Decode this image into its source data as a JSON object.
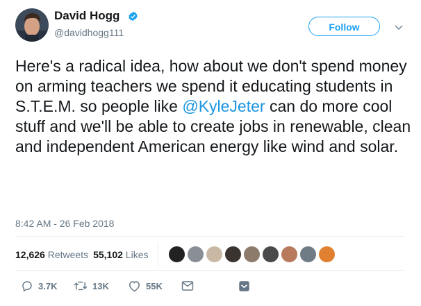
{
  "user": {
    "name": "David Hogg",
    "handle": "@davidhogg111"
  },
  "follow_label": "Follow",
  "tweet": {
    "before": "Here's a radical idea, how about we don't spend money on arming teachers we spend it educating  students in S.T.E.M. so people like ",
    "mention": "@KyleJeter",
    "after": " can do more cool stuff and we'll be able to create jobs in renewable, clean and independent American energy like wind and solar."
  },
  "timestamp": "8:42 AM - 26 Feb 2018",
  "stats": {
    "retweets_count": "12,626",
    "retweets_label": "Retweets",
    "likes_count": "55,102",
    "likes_label": "Likes"
  },
  "actions": {
    "replies": "3.7K",
    "retweets": "13K",
    "likes": "55K"
  },
  "colors": {
    "accent": "#1da1f2",
    "mention": "#1b95e0",
    "muted": "#657786"
  },
  "icons": [
    "verified-badge-icon",
    "chevron-down-icon",
    "reply-icon",
    "retweet-icon",
    "like-icon",
    "message-icon",
    "more-icon"
  ]
}
